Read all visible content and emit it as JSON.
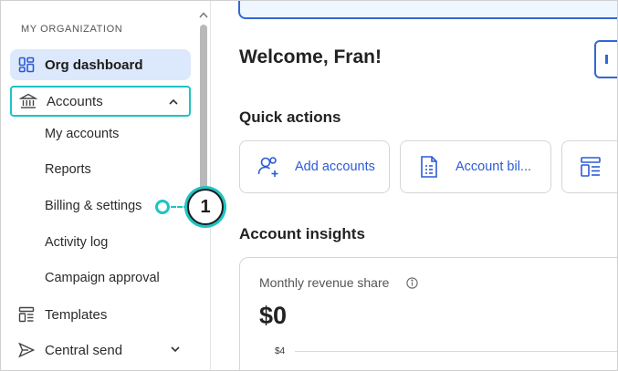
{
  "sidebar": {
    "org_label": "MY ORGANIZATION",
    "items": [
      {
        "label": "Org dashboard",
        "icon": "dashboard-icon",
        "active": true
      },
      {
        "label": "Accounts",
        "icon": "bank-icon",
        "expanded": true
      },
      {
        "label": "Templates",
        "icon": "templates-icon"
      },
      {
        "label": "Central send",
        "icon": "send-icon",
        "expanded": false
      }
    ],
    "accounts_children": [
      "My accounts",
      "Reports",
      "Billing & settings",
      "Activity log",
      "Campaign approval"
    ]
  },
  "callout": {
    "number": "1",
    "color": "#1fc3c3"
  },
  "main": {
    "welcome": "Welcome, Fran!",
    "quick_actions_title": "Quick actions",
    "quick_actions": [
      {
        "label": "Add accounts",
        "icon": "add-user-icon"
      },
      {
        "label": "Account bil...",
        "icon": "invoice-icon"
      },
      {
        "label": "",
        "icon": "layout-icon"
      }
    ],
    "insights_title": "Account insights",
    "metric_label": "Monthly revenue share",
    "metric_value": "$0",
    "chart_tick": "$4"
  },
  "colors": {
    "accent": "#2a5bd7",
    "active_bg": "#dce8fb",
    "highlight": "#1fc3c3"
  }
}
